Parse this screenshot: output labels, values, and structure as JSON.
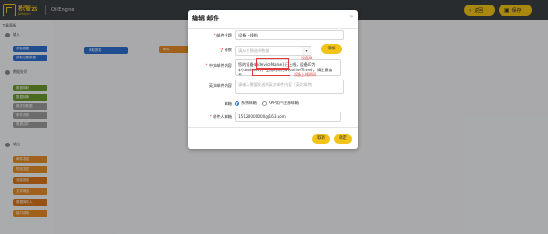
{
  "app": {
    "logo_name": "积智云",
    "logo_sub": "Jizhiyun",
    "engine": "Oil Engine"
  },
  "top_buttons": {
    "back": "返回",
    "save": "保存",
    "back_icon": "chevron-left-icon",
    "save_icon": "save-icon"
  },
  "left_panel": {
    "title": "工具面板",
    "sections": [
      {
        "label": "输入",
        "items": [
          {
            "label": "获取数据"
          },
          {
            "label": "获取后置数据"
          }
        ]
      },
      {
        "label": "数据处理",
        "items": [
          {
            "label": "数据映射"
          },
          {
            "label": "数据转换"
          },
          {
            "label": "格式化数据"
          },
          {
            "label": "条件判断"
          },
          {
            "label": "数据合并"
          }
        ]
      },
      {
        "label": "输出",
        "items": [
          {
            "label": "邮件发送"
          },
          {
            "label": "短信发送"
          },
          {
            "label": "消息推送"
          },
          {
            "label": "文件输出"
          },
          {
            "label": "数据库写入"
          },
          {
            "label": "接口调用"
          }
        ]
      }
    ]
  },
  "canvas": {
    "blocks": [
      {
        "label": "获取数据"
      },
      {
        "label": "邮件"
      }
    ]
  },
  "modal": {
    "title": "编辑 邮件",
    "close": "×",
    "subject_label": "邮件主题",
    "subject_value": "设备上线啦",
    "params_label": "参数",
    "params_placeholder": "请从左侧选择数据",
    "add_button": "添加",
    "cn_content_label": "中文邮件内容",
    "cn_content_value": "您的设备${deviceName}已上线，设备ID为${deviceId}，上线时间为${onlineTime}，请注意查看。",
    "en_content_label": "英文邮件内容",
    "en_content_placeholder": "请输入需要发送的英文邮件内容（英文邮件）",
    "mailbox_label": "邮箱",
    "mailbox_options": [
      "系统邮箱",
      "APP用户注册邮箱"
    ],
    "mailbox_selected": 0,
    "recipient_label": "收件人邮箱",
    "recipient_value": "15120000000@163.com",
    "cancel_button": "取消",
    "ok_button": "确定"
  },
  "annotations": {
    "first": "设备ID",
    "second": "设备上线时间"
  },
  "colors": {
    "accent": "#f2c318",
    "topbar": "#3a3f44",
    "highlight": "#e03a3a",
    "blue": "#2f6fd0",
    "green": "#6a9a2b",
    "orange": "#e58d26"
  }
}
